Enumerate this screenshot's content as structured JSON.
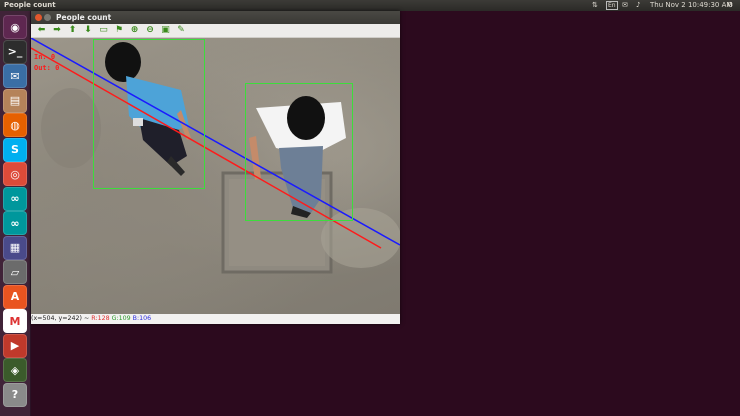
{
  "panel": {
    "window_title": "People count",
    "keyboard_layout": "En",
    "clock": "Thu Nov  2 10:49:30 AM"
  },
  "window": {
    "title": "People count",
    "toolbar": [
      {
        "name": "pan-left-icon",
        "glyph": "⬅"
      },
      {
        "name": "pan-right-icon",
        "glyph": "➡"
      },
      {
        "name": "pan-up-icon",
        "glyph": "⬆"
      },
      {
        "name": "pan-down-icon",
        "glyph": "⬇"
      },
      {
        "name": "zoom-fit-icon",
        "glyph": "▭"
      },
      {
        "name": "zoom-original-icon",
        "glyph": "⚑"
      },
      {
        "name": "zoom-in-icon",
        "glyph": "⊕"
      },
      {
        "name": "zoom-out-icon",
        "glyph": "⊖"
      },
      {
        "name": "save-icon",
        "glyph": "▣"
      },
      {
        "name": "properties-icon",
        "glyph": "✎"
      }
    ],
    "overlay": {
      "in_label": "In: 0",
      "out_label": "Out: 0"
    },
    "status": {
      "coords": "(x=504, y=242) ~",
      "r": "R:128",
      "g": "G:109",
      "b": "B:106"
    }
  },
  "launcher": [
    {
      "name": "ubuntu-dash-icon",
      "glyph": "◉",
      "bg": "#5e2750"
    },
    {
      "name": "terminal-icon",
      "glyph": ">_",
      "bg": "#2d2d2d"
    },
    {
      "name": "thunderbird-icon",
      "glyph": "✉",
      "bg": "#3a6ea5"
    },
    {
      "name": "files-icon",
      "glyph": "▤",
      "bg": "#b5835a"
    },
    {
      "name": "firefox-icon",
      "glyph": "◍",
      "bg": "#e66000"
    },
    {
      "name": "skype-icon",
      "glyph": "S",
      "bg": "#00aff0"
    },
    {
      "name": "chrome-icon",
      "glyph": "◎",
      "bg": "#dd4b39"
    },
    {
      "name": "arduino-icon-1",
      "glyph": "∞",
      "bg": "#00979c"
    },
    {
      "name": "arduino-icon-2",
      "glyph": "∞",
      "bg": "#00979c"
    },
    {
      "name": "remote-desktop-icon",
      "glyph": "▦",
      "bg": "#4a4a8a"
    },
    {
      "name": "scanner-icon",
      "glyph": "▱",
      "bg": "#6b6b6b"
    },
    {
      "name": "ubuntu-software-icon",
      "glyph": "A",
      "bg": "#e95420"
    },
    {
      "name": "gmail-icon",
      "glyph": "M",
      "bg": "#ffffff"
    },
    {
      "name": "media-icon",
      "glyph": "▶",
      "bg": "#c0392b"
    },
    {
      "name": "remmina-icon",
      "glyph": "◈",
      "bg": "#3b5b2b"
    },
    {
      "name": "help-icon",
      "glyph": "?",
      "bg": "#8a8a8a"
    }
  ],
  "colors": {
    "detection_box": "#3cdd3c",
    "red_line": "#ff1a1a",
    "blue_line": "#1a1aff"
  }
}
